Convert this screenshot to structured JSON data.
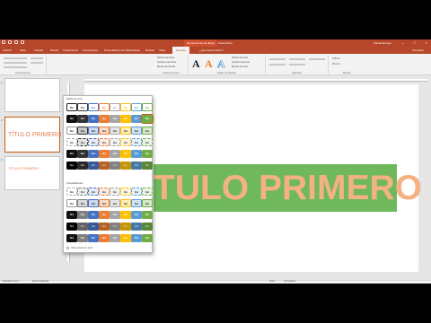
{
  "window": {
    "title": "Presentación1 - PowerPoint",
    "context_tab": "Herramientas de dibujo",
    "user": "Daniel Enrique",
    "controls": [
      "–",
      "□",
      "×"
    ]
  },
  "ribbon_tabs": [
    "Archivo",
    "Inicio",
    "Insertar",
    "Diseño",
    "Transiciones",
    "Animaciones",
    "Presentación con diapositivas",
    "Revisar",
    "Vista",
    "Formato",
    "¿Qué desea hacer?"
  ],
  "ribbon": {
    "insert_shapes_group": "Insertar formas",
    "shape_fill": "Relleno de forma",
    "shape_outline": "Contorno de forma",
    "shape_effects": "Efectos de formas",
    "shape_styles_group": "Estilos de forma",
    "text_fill": "Relleno de texto",
    "text_outline": "Contorno de texto",
    "text_effects": "Efectos de texto",
    "wordart_group": "Estilos de WordArt",
    "wordart_letter": "A",
    "arrange_group": "Organizar",
    "size_group": "Tamaño",
    "height": "3,85 cm",
    "width": "25,4 cm",
    "share": "Compartir"
  },
  "thumbnails": [
    {
      "number": "1",
      "title": ""
    },
    {
      "number": "2",
      "title": "TÍTULO PRIMERO"
    },
    {
      "number": "3",
      "title": "TÍTULO PRIMERO"
    }
  ],
  "slide": {
    "title_text": "TULO PRIMERO",
    "title_fill_color": "#70b85c",
    "title_text_color": "#f4b183"
  },
  "gallery": {
    "theme_styles_header": "Estilos de tema",
    "presets_header": "Preestablecidos",
    "swatch_text": "Abc",
    "footer": "Otros rellenos de tema",
    "theme_colors": [
      "#ffffff",
      "#333333",
      "#4472c4",
      "#ed7d31",
      "#a5a5a5",
      "#ffc000",
      "#5b9bd5",
      "#70ad47"
    ],
    "preset_colors": [
      "#ffffff",
      "#7f7f7f",
      "#4472c4",
      "#ed7d31",
      "#a5a5a5",
      "#ffc000",
      "#5b9bd5",
      "#70ad47"
    ]
  },
  "status": {
    "slide_info": "Diapositiva 2 de 3",
    "language": "Español (España)",
    "notes": "Notas",
    "comments": "Comentarios"
  }
}
